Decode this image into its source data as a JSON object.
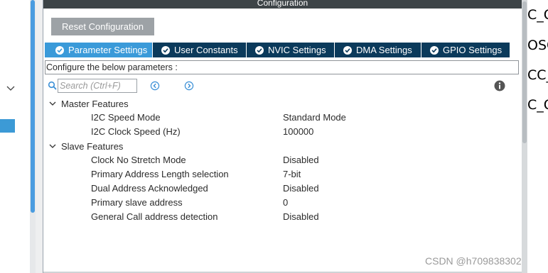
{
  "panel": {
    "title": "Configuration",
    "reset_button": "Reset Configuration"
  },
  "tabs": [
    {
      "label": "Parameter Settings",
      "active": true
    },
    {
      "label": "User Constants",
      "active": false
    },
    {
      "label": "NVIC Settings",
      "active": false
    },
    {
      "label": "DMA Settings",
      "active": false
    },
    {
      "label": "GPIO Settings",
      "active": false
    }
  ],
  "description": "Configure the below parameters :",
  "search": {
    "placeholder": "Search (Ctrl+F)",
    "value": ""
  },
  "groups": [
    {
      "label": "Master Features",
      "expanded": true,
      "params": [
        {
          "name": "I2C Speed Mode",
          "value": "Standard Mode"
        },
        {
          "name": "I2C Clock Speed (Hz)",
          "value": "100000"
        }
      ]
    },
    {
      "label": "Slave Features",
      "expanded": true,
      "params": [
        {
          "name": "Clock No Stretch Mode",
          "value": "Disabled"
        },
        {
          "name": "Primary Address Length selection",
          "value": "7-bit"
        },
        {
          "name": "Dual Address Acknowledged",
          "value": "Disabled"
        },
        {
          "name": "Primary slave address",
          "value": "0"
        },
        {
          "name": "General Call address detection",
          "value": "Disabled"
        }
      ]
    }
  ],
  "right_edge_text": [
    "C_O",
    "OSC",
    "CC_",
    "C_O"
  ],
  "watermark": "CSDN @h709838302",
  "colors": {
    "tab_bar": "#0b3a5b",
    "tab_active": "#3a9ad9",
    "title_bar": "#3d4447",
    "reset_button": "#9da2a6"
  }
}
